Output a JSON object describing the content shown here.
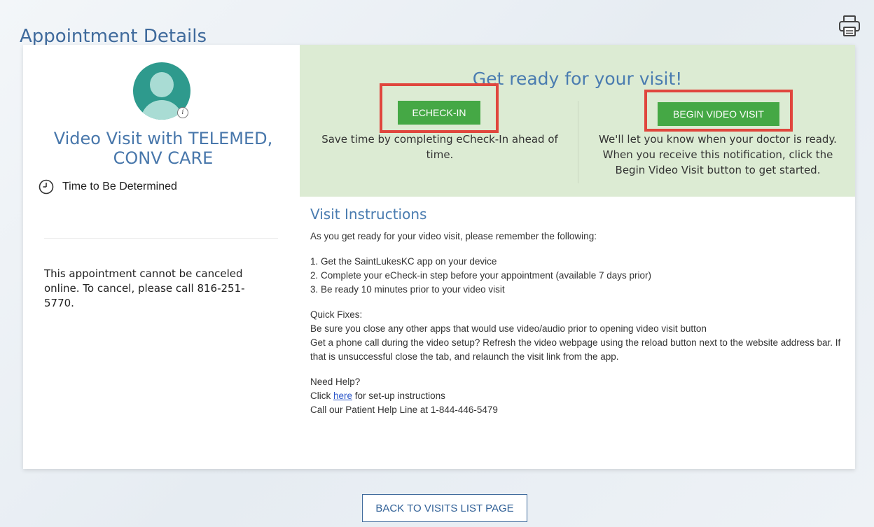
{
  "page": {
    "title": "Appointment Details",
    "print_icon": "printer-icon"
  },
  "appointment": {
    "title": "Video Visit with TELEMED, CONV CARE",
    "time_label": "Time to Be Determined",
    "avatar_icon": "provider-avatar",
    "info_badge": "i",
    "cancel_text": "This appointment cannot be canceled online. To cancel, please call 816-251-5770."
  },
  "ready": {
    "heading": "Get ready for your visit!",
    "echeckin": {
      "label": "ECHECK-IN",
      "description": "Save time by completing eCheck-In ahead of time."
    },
    "video": {
      "label": "BEGIN VIDEO VISIT",
      "description": "We'll let you know when your doctor is ready. When you receive this notification, click the Begin Video Visit button to get started."
    }
  },
  "instructions": {
    "heading": "Visit Instructions",
    "intro": "As you get ready for your video visit, please remember the following:",
    "steps": [
      "1. Get the SaintLukesKC app on your device",
      "2. Complete your eCheck-in step before your appointment (available 7 days prior)",
      "3. Be ready 10 minutes prior to your video visit"
    ],
    "quick_fixes_heading": "Quick Fixes:",
    "quick_fixes": [
      "Be sure you close any other apps that would use video/audio prior to opening video visit button",
      "Get a phone call during the video setup? Refresh the video webpage using the reload button next to the website address bar. If that is unsuccessful close the tab, and relaunch the visit link from the app."
    ],
    "help_heading": "Need Help?",
    "help_prefix": "Click ",
    "help_link": "here",
    "help_suffix": " for set-up instructions",
    "help_line": "Call our Patient Help Line at 1-844-446-5479"
  },
  "footer": {
    "back_label": "BACK TO VISITS LIST PAGE"
  },
  "colors": {
    "accent_blue": "#4a7cb0",
    "button_green": "#45a845",
    "highlight_red": "#e0463d",
    "ready_panel_bg": "#dcebd3",
    "avatar_teal": "#2e9a8d"
  }
}
